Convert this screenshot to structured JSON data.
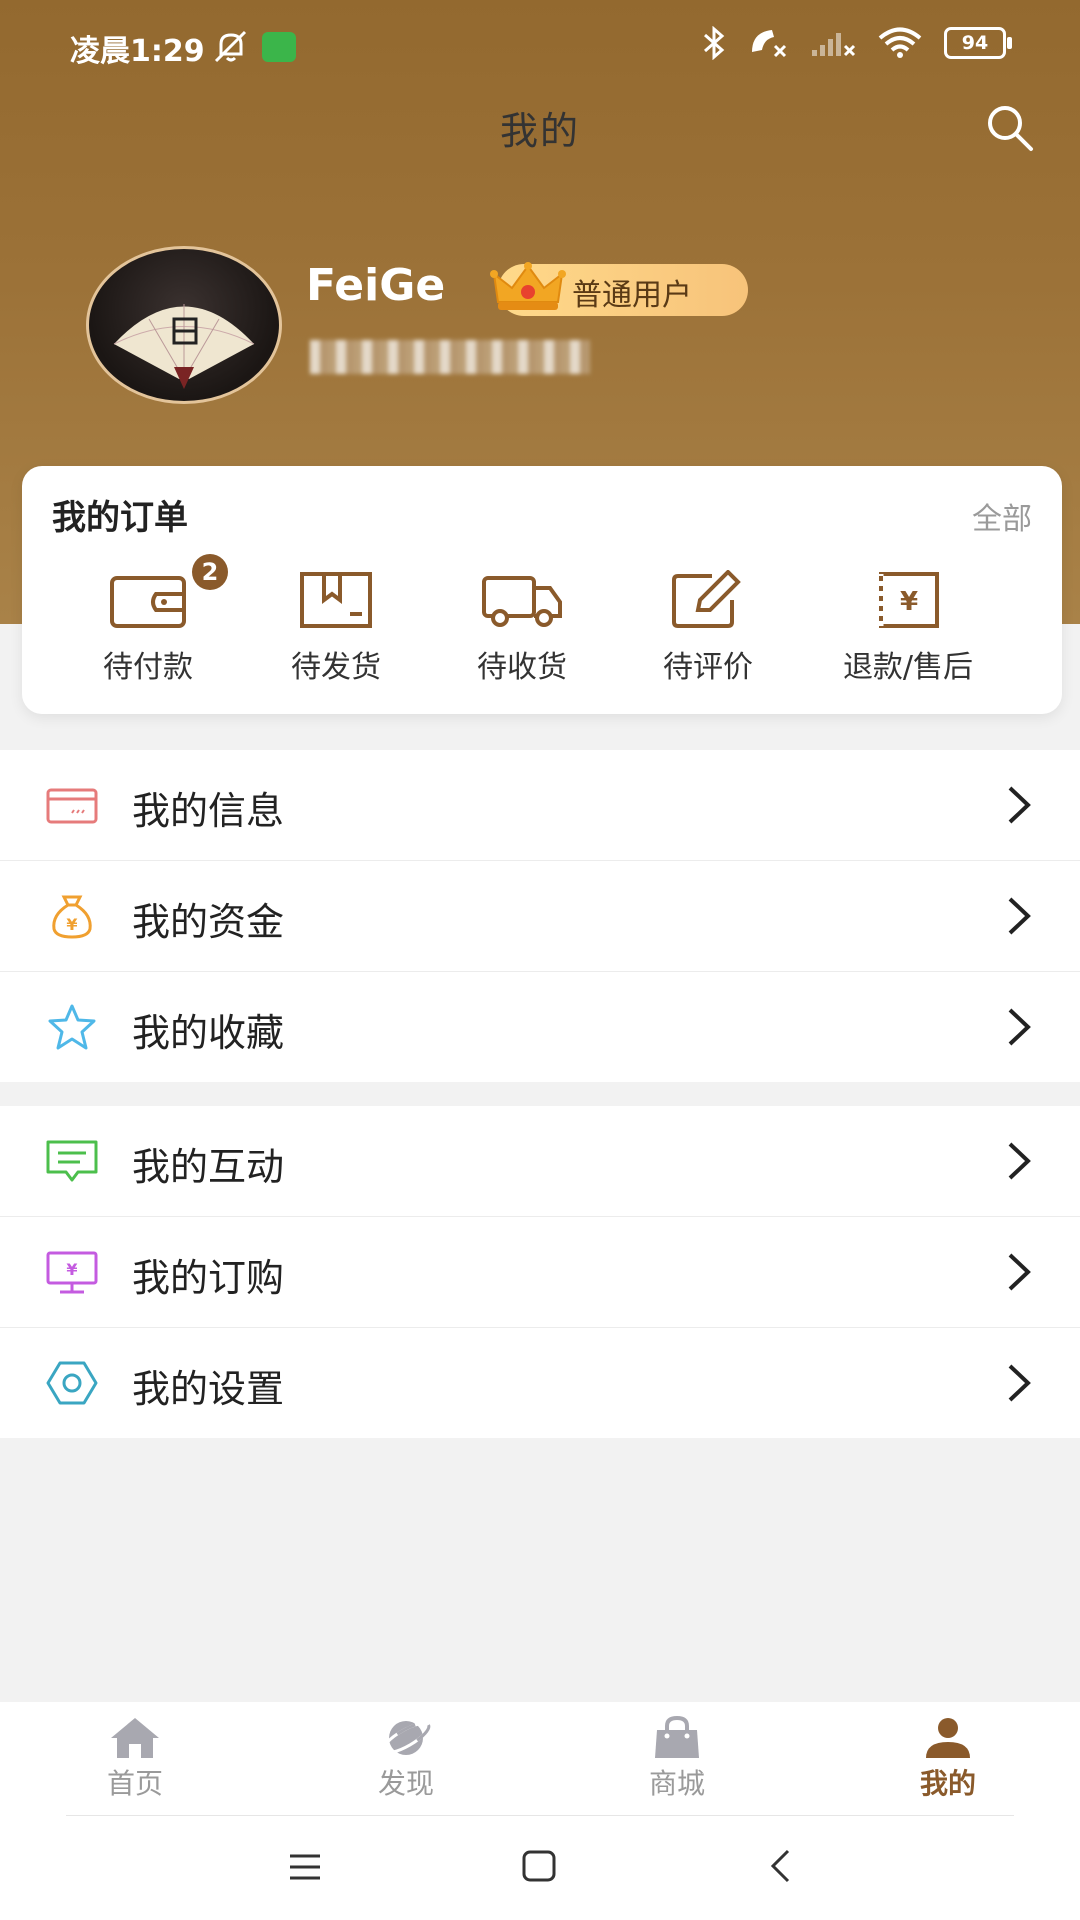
{
  "status_bar": {
    "time": "凌晨1:29",
    "battery": "94"
  },
  "header": {
    "title": "我的"
  },
  "profile": {
    "name": "FeiGe",
    "badge": "普通用户"
  },
  "orders": {
    "title": "我的订单",
    "all_label": "全部",
    "items": [
      {
        "label": "待付款",
        "count": "2"
      },
      {
        "label": "待发货"
      },
      {
        "label": "待收货"
      },
      {
        "label": "待评价"
      },
      {
        "label": "退款/售后"
      }
    ]
  },
  "menu_group1": [
    {
      "label": "我的信息",
      "icon": "card-icon",
      "color": "#e67b7b"
    },
    {
      "label": "我的资金",
      "icon": "money-bag-icon",
      "color": "#f0a030"
    },
    {
      "label": "我的收藏",
      "icon": "star-icon",
      "color": "#4fb8e8"
    }
  ],
  "menu_group2": [
    {
      "label": "我的互动",
      "icon": "message-icon",
      "color": "#4cbf4c"
    },
    {
      "label": "我的订购",
      "icon": "monitor-yen-icon",
      "color": "#c45be0"
    },
    {
      "label": "我的设置",
      "icon": "gear-icon",
      "color": "#3aa6c2"
    }
  ],
  "tabs": [
    {
      "label": "首页",
      "icon": "home-icon"
    },
    {
      "label": "发现",
      "icon": "planet-icon"
    },
    {
      "label": "商城",
      "icon": "shopping-bag-icon"
    },
    {
      "label": "我的",
      "icon": "user-icon",
      "active": true
    }
  ],
  "colors": {
    "brand": "#93692f",
    "accent": "#8a5a2b"
  }
}
